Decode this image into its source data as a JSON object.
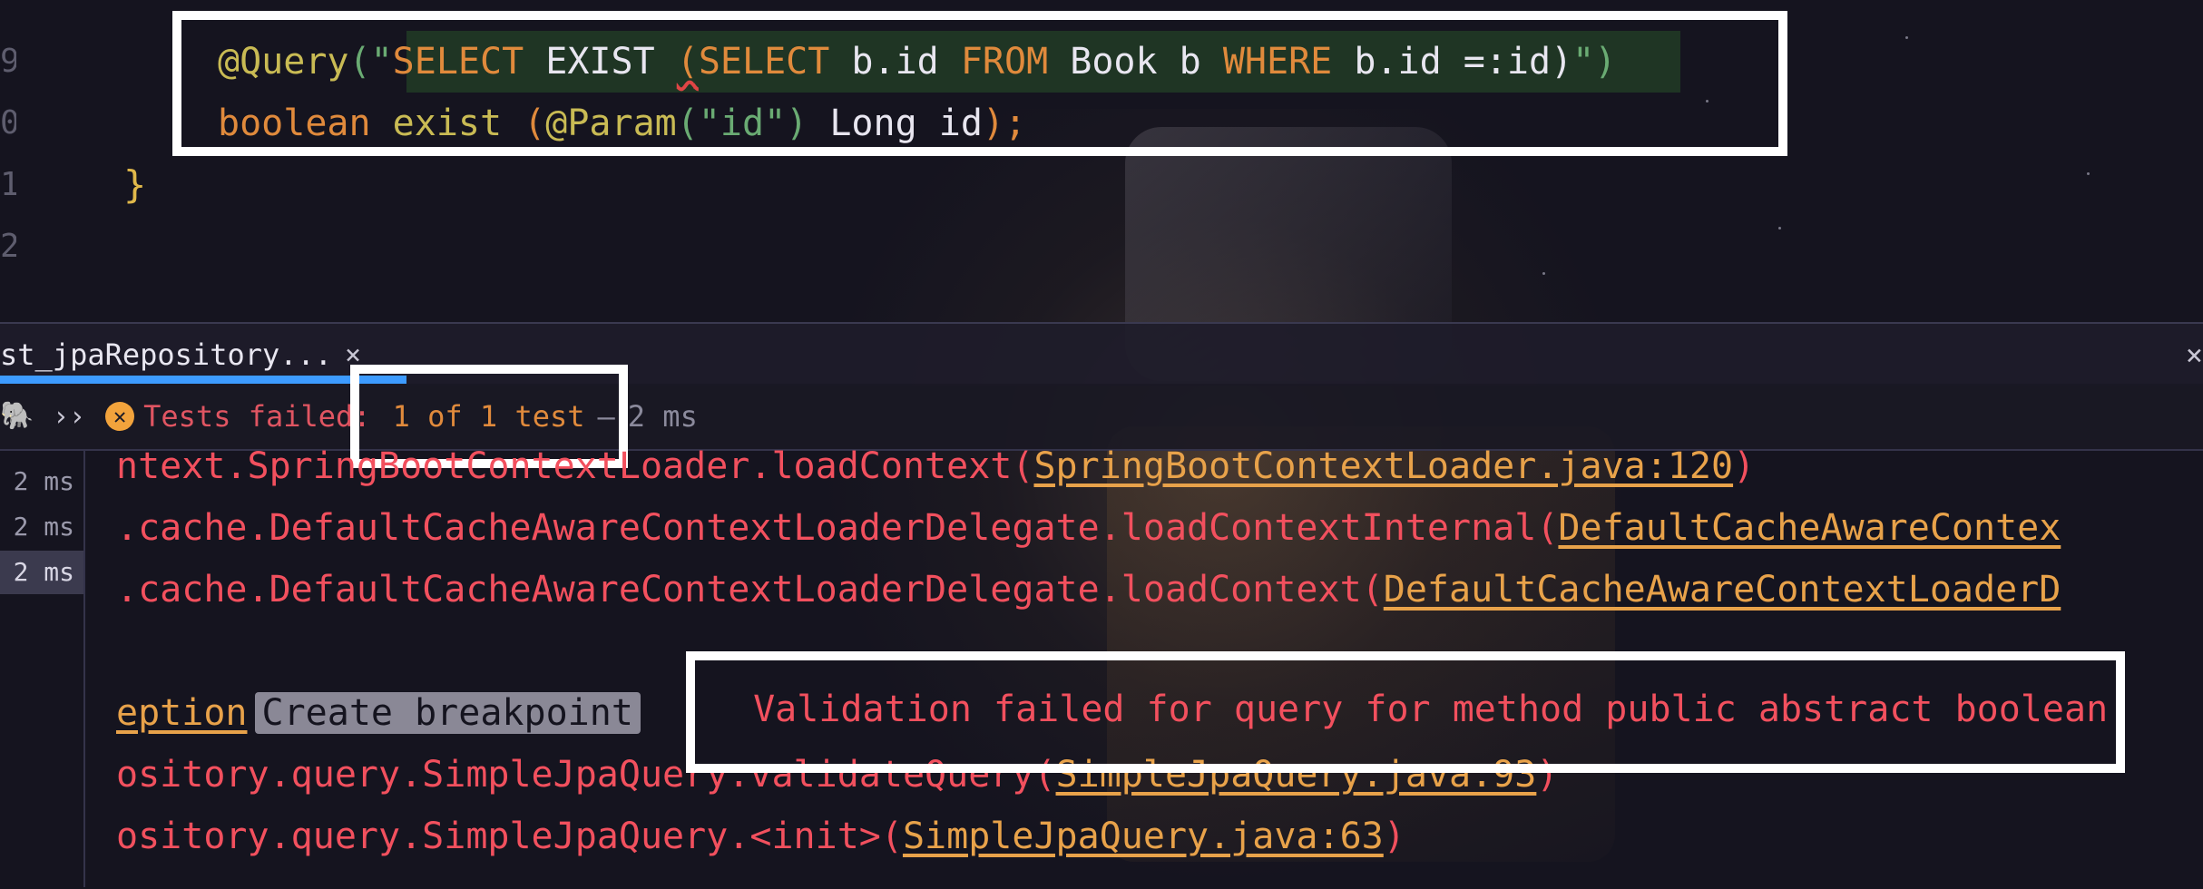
{
  "editor": {
    "gutter": [
      "9",
      "0",
      "1",
      "2"
    ],
    "line1": {
      "annotation": "@Query",
      "paren_open": "(\"",
      "kw_select": "SELECT",
      "exist": " EXIST ",
      "paren2": "(",
      "kw_select2": "SELECT",
      "bid": " b.id ",
      "kw_from": "FROM",
      "book": " Book b ",
      "kw_where": "WHERE",
      "cond": " b.id =:id)",
      "close": "\")"
    },
    "line2": {
      "kw_boolean": "boolean",
      "method": " exist ",
      "paren_open": "(",
      "param_ann": "@Param",
      "param_open": "(",
      "param_str": "\"id\"",
      "param_close": ")",
      "type_arg": " Long id",
      "end": ");"
    },
    "closing_brace": "}"
  },
  "run_panel": {
    "tab_label": "st_jpaRepository...",
    "tab_close": "×",
    "panel_close": "×",
    "toolbar": {
      "elephant_icon": "elephant-icon",
      "chevron": "››",
      "status": "Tests failed:",
      "count": "1 of 1 test",
      "dash": "–",
      "time": "2 ms"
    },
    "tree_times": [
      "2 ms",
      "2 ms",
      "2 ms"
    ]
  },
  "console": {
    "lines": [
      {
        "prefix": "ntext.SpringBootContextLoader.loadContext(",
        "link": "SpringBootContextLoader.java:120",
        "suffix": ")"
      },
      {
        "prefix": ".cache.DefaultCacheAwareContextLoaderDelegate.loadContextInternal(",
        "link": "DefaultCacheAwareContex",
        "suffix": ""
      },
      {
        "prefix": ".cache.DefaultCacheAwareContextLoaderDelegate.loadContext(",
        "link": "DefaultCacheAwareContextLoaderD",
        "suffix": ""
      }
    ],
    "exception_link": "eption",
    "breakpoint_chip": "Create breakpoint",
    "message": " Validation failed for query for method public abstract boolean",
    "stack": [
      {
        "prefix": "ository.query.SimpleJpaQuery.validateQuery(",
        "link": "SimpleJpaQuery.java:93",
        "suffix": ")"
      },
      {
        "prefix": "ository.query.SimpleJpaQuery.<init>(",
        "link": "SimpleJpaQuery.java:63",
        "suffix": ")"
      }
    ]
  }
}
